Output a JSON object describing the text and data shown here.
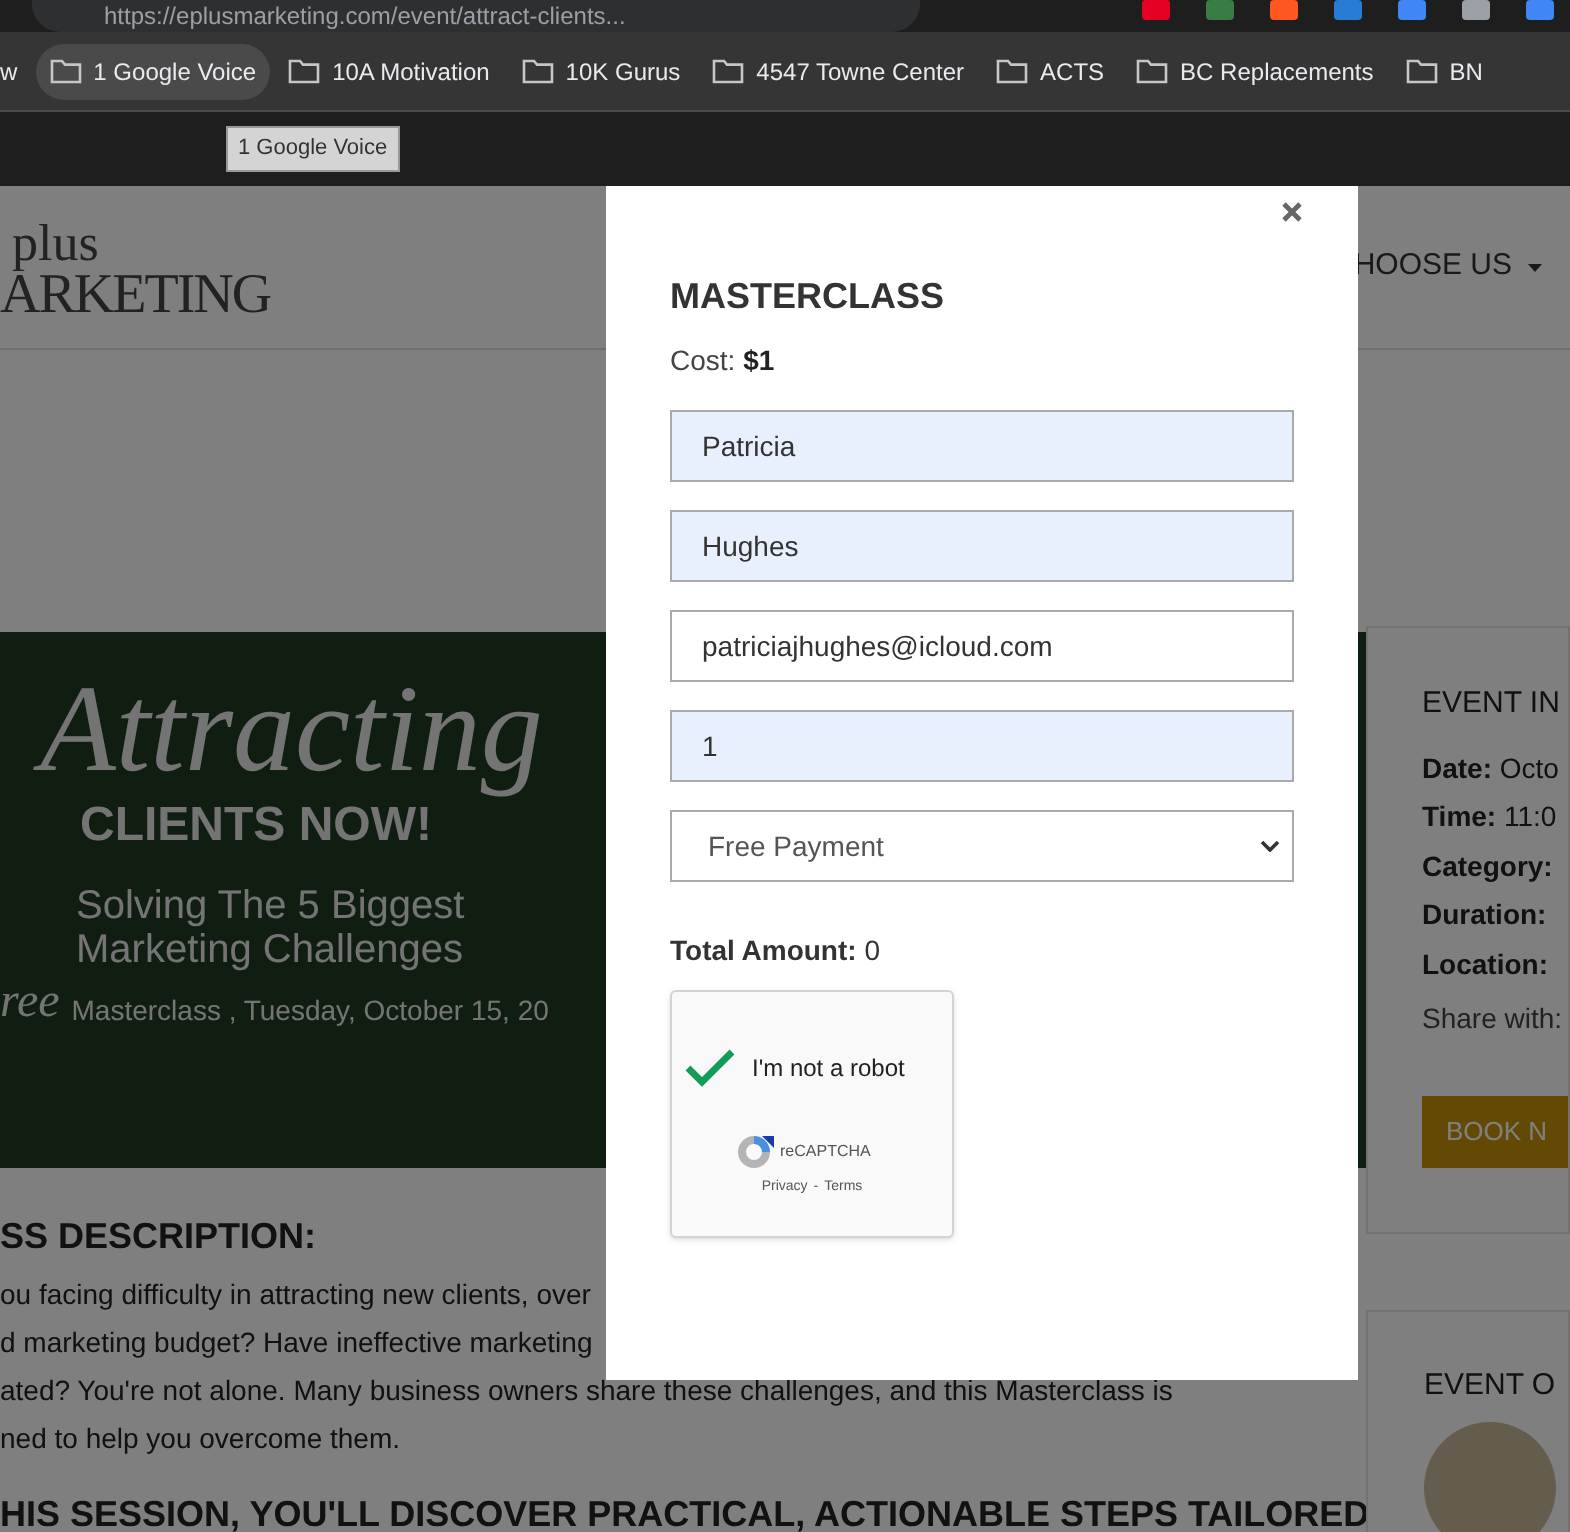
{
  "browser": {
    "address": "https://eplusmarketing.com/event/attract-clients...",
    "bookmarks": [
      {
        "label": "w",
        "kind": "link",
        "hovered": false
      },
      {
        "label": "1 Google Voice",
        "kind": "folder",
        "hovered": true
      },
      {
        "label": "10A Motivation",
        "kind": "folder",
        "hovered": false
      },
      {
        "label": "10K Gurus",
        "kind": "folder",
        "hovered": false
      },
      {
        "label": "4547 Towne Center",
        "kind": "folder",
        "hovered": false
      },
      {
        "label": "ACTS",
        "kind": "folder",
        "hovered": false
      },
      {
        "label": "BC Replacements",
        "kind": "folder",
        "hovered": false
      },
      {
        "label": "BN",
        "kind": "folder",
        "hovered": false
      }
    ],
    "tooltip": "1 Google Voice"
  },
  "page": {
    "logo": {
      "top": "plus",
      "bottom": "ARKETING"
    },
    "nav_item": "HOOSE US",
    "banner": {
      "script": "Attracting",
      "headline": "CLIENTS NOW!",
      "subtitle": [
        "Solving The 5 Biggest",
        "Marketing Challenges"
      ],
      "tag": "ree",
      "date": "Masterclass , Tuesday, October 15, 20"
    },
    "description": {
      "heading": "SS DESCRIPTION:",
      "lines": [
        "ou facing difficulty in attracting new clients, over",
        "d marketing budget? Have ineffective marketing",
        "ated? You're not alone. Many business owners share these challenges, and this Masterclass is",
        "ned to help you overcome them."
      ]
    },
    "session_heading": "HIS SESSION, YOU'LL DISCOVER PRACTICAL, ACTIONABLE STEPS TAILORED",
    "event_info": {
      "heading": "EVENT IN",
      "rows": [
        {
          "label": "Date:",
          "value": "Octo"
        },
        {
          "label": "Time:",
          "value": "11:0"
        },
        {
          "label": "Category:"
        },
        {
          "label": "Duration:"
        },
        {
          "label": "Location:"
        }
      ],
      "share": "Share with:",
      "button": "BOOK N"
    },
    "organizer": {
      "heading": "EVENT O"
    }
  },
  "modal": {
    "title": "MASTERCLASS",
    "cost": {
      "label": "Cost:",
      "value": "$1"
    },
    "fields": [
      {
        "kind": "text",
        "value": "Patricia",
        "autofilled": true
      },
      {
        "kind": "text",
        "value": "Hughes",
        "autofilled": true
      },
      {
        "kind": "text",
        "value": "patriciajhughes@icloud.com",
        "autofilled": false
      },
      {
        "kind": "text",
        "value": "1",
        "autofilled": true
      },
      {
        "kind": "select",
        "value": "Free Payment"
      }
    ],
    "total": {
      "label": "Total Amount:",
      "value": "0"
    },
    "captcha": {
      "label": "I'm not a robot",
      "checked": true,
      "brand": "reCAPTCHA",
      "links": [
        "Privacy",
        "Terms"
      ],
      "separator": "-"
    }
  }
}
